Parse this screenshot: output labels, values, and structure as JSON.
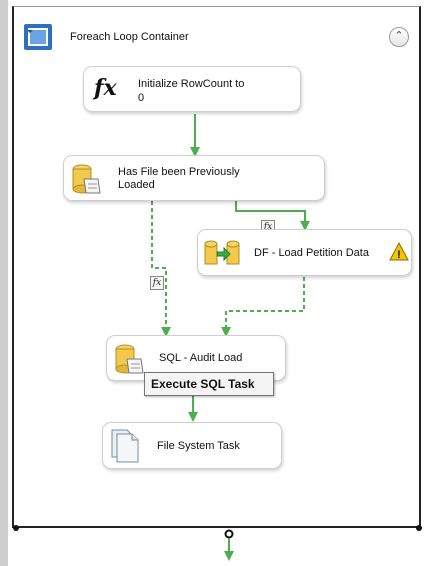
{
  "container": {
    "title": "Foreach Loop Container",
    "collapse_glyph": "⌃",
    "icon": "foreach-loop-icon"
  },
  "tasks": {
    "initialize": {
      "label_line1": "Initialize RowCount to",
      "label_line2": "0",
      "icon": "fx-expression-icon",
      "icon_glyph": "fx"
    },
    "has_file": {
      "label_line1": "Has File been Previously",
      "label_line2": "Loaded",
      "icon": "execute-sql-icon"
    },
    "df_load": {
      "label": "DF - Load Petition Data",
      "icon": "data-flow-icon",
      "warning": "!"
    },
    "sql_audit": {
      "label": "SQL - Audit Load",
      "icon": "execute-sql-icon"
    },
    "file_system": {
      "label": "File System Task",
      "icon": "file-system-icon"
    }
  },
  "tooltip": {
    "text": "Execute SQL Task"
  },
  "constraints": {
    "fx_glyph": "fx"
  },
  "colors": {
    "success": "#4cae4c",
    "completion": "#4cae4c",
    "warning": "#f2c500"
  }
}
